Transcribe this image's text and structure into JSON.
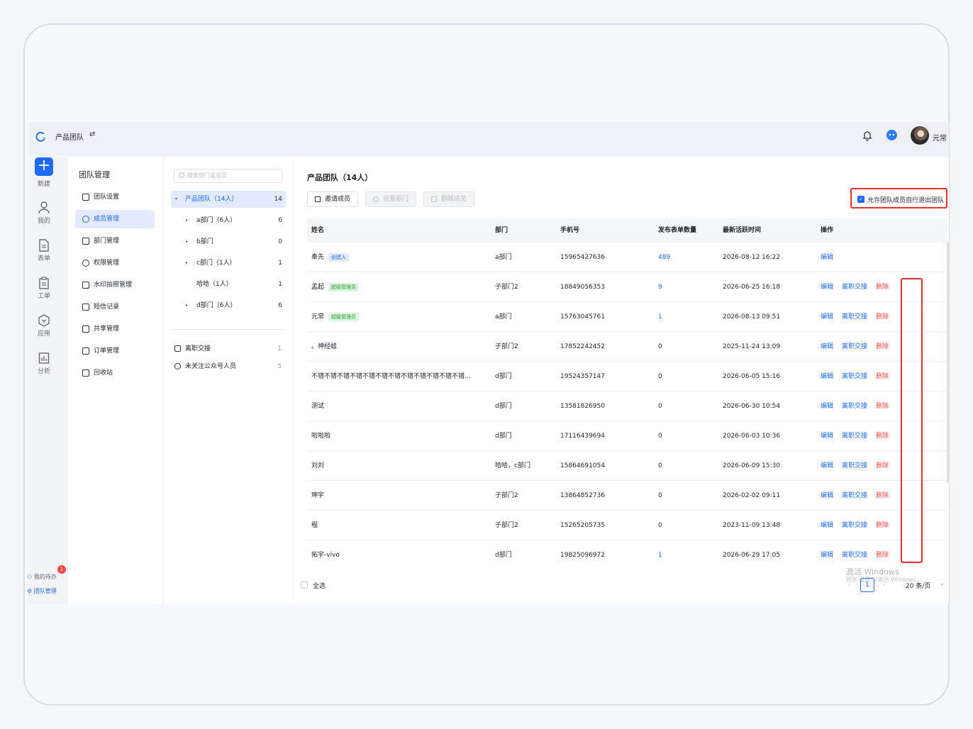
{
  "topbar": {
    "team_name": "产品团队",
    "switch_icon": "⇄",
    "user_name": "元常"
  },
  "nav": {
    "new_icon": "+",
    "new_label": "新建",
    "mine": "我的",
    "forms": "表单",
    "tickets": "工单",
    "apps": "应用",
    "analysis": "分析",
    "todo": "我的待办",
    "todo_badge": "1",
    "team_mgmt": "团队管理"
  },
  "menu": {
    "title": "团队管理",
    "items": [
      {
        "label": "团队设置"
      },
      {
        "label": "成员管理"
      },
      {
        "label": "部门管理"
      },
      {
        "label": "权限管理"
      },
      {
        "label": "水印拍照管理"
      },
      {
        "label": "短信记录"
      },
      {
        "label": "共享管理"
      },
      {
        "label": "订单管理"
      },
      {
        "label": "回收站"
      }
    ]
  },
  "dept": {
    "search_placeholder": "搜索部门或成员",
    "tree": [
      {
        "label": "产品团队（14人）",
        "count": "14"
      },
      {
        "label": "a部门（6人）",
        "count": "6"
      },
      {
        "label": "b部门",
        "count": "0"
      },
      {
        "label": "c部门（1人）",
        "count": "1"
      },
      {
        "label": "哈哈（1人）",
        "count": "1"
      },
      {
        "label": "d部门（6人）",
        "count": "6"
      }
    ],
    "extras": [
      {
        "label": "离职交接",
        "count": "1"
      },
      {
        "label": "未关注公众号人员",
        "count": "5"
      }
    ]
  },
  "main": {
    "title": "产品团队（14人）",
    "buttons": {
      "invite": "邀请成员",
      "set_dept": "设置部门",
      "delete": "删除成员"
    },
    "allow_exit_label": "允许团队成员自行退出团队",
    "columns": {
      "name": "姓名",
      "dept": "部门",
      "phone": "手机号",
      "forms": "发布表单数量",
      "last_active": "最新活跃时间",
      "actions": "操作"
    },
    "action_labels": {
      "edit": "编辑",
      "handover": "离职交接",
      "delete": "删除"
    },
    "rows": [
      {
        "name": "奉先",
        "tag": "创建人",
        "dept": "a部门",
        "phone": "15965427636",
        "forms": "489",
        "time": "2026-08-12 16:22"
      },
      {
        "name": "孟起",
        "tag": "超级管理员",
        "dept": "子部门2",
        "phone": "18849056353",
        "forms": "9",
        "time": "2026-06-25 16:18"
      },
      {
        "name": "元常",
        "tag": "超级管理员",
        "dept": "a部门",
        "phone": "15763045761",
        "forms": "1",
        "time": "2026-08-13 09:51"
      },
      {
        "name": "。神经蛙",
        "tag": "",
        "dept": "子部门2",
        "phone": "17852242452",
        "forms": "0",
        "time": "2025-11-24 13:09"
      },
      {
        "name": "不错不错不错不错不错不错不错不错不错不错不错不错...",
        "tag": "",
        "dept": "d部门",
        "phone": "19524357147",
        "forms": "0",
        "time": "2026-06-05 15:16"
      },
      {
        "name": "测试",
        "tag": "",
        "dept": "d部门",
        "phone": "13581826950",
        "forms": "0",
        "time": "2026-06-30 10:54"
      },
      {
        "name": "啦啦啦",
        "tag": "",
        "dept": "d部门",
        "phone": "17116439694",
        "forms": "0",
        "time": "2026-06-03 10:36"
      },
      {
        "name": "刘刘",
        "tag": "",
        "dept": "哈哈，c部门",
        "phone": "15864691054",
        "forms": "0",
        "time": "2026-06-09 15:30"
      },
      {
        "name": "珅宇",
        "tag": "",
        "dept": "子部门2",
        "phone": "13864852736",
        "forms": "0",
        "time": "2026-02-02 09:11"
      },
      {
        "name": "程",
        "tag": "",
        "dept": "子部门2",
        "phone": "15265205735",
        "forms": "0",
        "time": "2023-11-09 13:48"
      },
      {
        "name": "拓宇-vivo",
        "tag": "",
        "dept": "d部门",
        "phone": "19825096972",
        "forms": "1",
        "time": "2026-06-29 17:05"
      }
    ],
    "footer": {
      "select_all": "全选",
      "prev": "‹",
      "page": "1",
      "next": "›",
      "page_size": "20 条/页"
    },
    "watermark": {
      "line1": "激活 Windows",
      "line2": "转到'设置'以激活 Windows。"
    }
  },
  "colors": {
    "accent": "#1f6bff",
    "danger": "#f54a45",
    "highlight": "#e5302b"
  }
}
